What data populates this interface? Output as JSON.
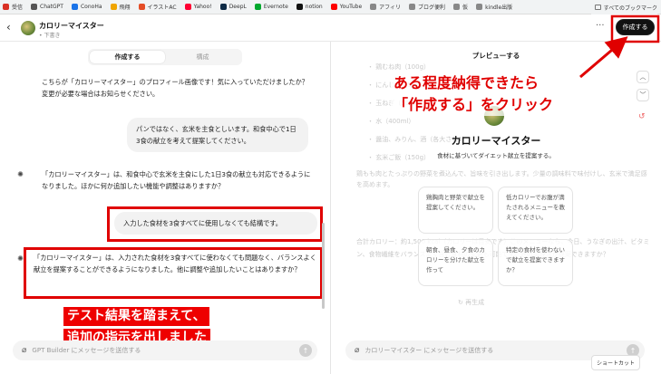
{
  "bookmarks": [
    {
      "label": "受信",
      "color": "#d93025"
    },
    {
      "label": "ChatGPT",
      "color": "#555555"
    },
    {
      "label": "ConoHa",
      "color": "#1a73e8"
    },
    {
      "label": "飛翔",
      "color": "#f0a500"
    },
    {
      "label": "イラストAC",
      "color": "#e44d26"
    },
    {
      "label": "Yahoo!",
      "color": "#ff0033"
    },
    {
      "label": "DeepL",
      "color": "#0f2b46"
    },
    {
      "label": "Evernote",
      "color": "#00a82d"
    },
    {
      "label": "notion",
      "color": "#111111"
    },
    {
      "label": "YouTube",
      "color": "#ff0000"
    },
    {
      "label": "アフィリ",
      "color": "#888888"
    },
    {
      "label": "ブログ便利",
      "color": "#888888"
    },
    {
      "label": "仮",
      "color": "#888888"
    },
    {
      "label": "kindle出版",
      "color": "#888888"
    }
  ],
  "bookmarks_all": "すべてのブックマーク",
  "header": {
    "back": "‹",
    "title": "カロリーマイスター",
    "subtitle": "• 下書き",
    "more": "···",
    "create_label": "作成する"
  },
  "tabs": {
    "create": "作成する",
    "configure": "構成"
  },
  "chat": {
    "m1": "こちらが「カロリーマイスター」のプロフィール画像です！気に入っていただけましたか？変更が必要な場合はお知らせください。",
    "u1": "パンではなく、玄米を主食としいます。和食中心で1日3食の献立を考えて提案してください。",
    "m2": "「カロリーマイスター」は、和食中心で玄米を主食にした1日3食の献立も対応できるようになりました。ほかに何か追加したい機能や調整はありますか？",
    "u2": "入力した食材を3食すべてに使用しなくても結構です。",
    "m3": "「カロリーマイスター」は、入力された食材を3食すべてに使わなくても問題なく、バランスよく献立を提案することができるようになりました。他に調整や追加したいことはありますか？"
  },
  "annotation_left": [
    "テスト結果を踏まえて、",
    "追加の指示を出しました"
  ],
  "left_input_placeholder": "GPT Builder にメッセージを送信する",
  "preview": {
    "title": "プレビューする",
    "faded_lines": [
      "・ 鶏むね肉（100g）",
      "・ にんじん（50g）",
      "・ 玉ねぎ（50g）",
      "・ 水（400ml）",
      "・ 醤油、みりん、酒（各大さじ1）",
      "・ 玄米ご飯（150g）"
    ],
    "faded_p1": "鶏もも肉とたっぷりの野菜を煮込んで、旨味を引き出します。少量の調味料で味付けし、玄米で満足感を高めます。",
    "faded_p2": "合計カロリー：約1,500 kcal（カロリーは目安です）このメニューなら、今日、うなぎの出汁、ビタミン、食物繊維をバランスよく含む食材の変更も可能です。他の調理法が提案できますか？",
    "gpt_name": "カロリーマイスター",
    "gpt_desc": "食材に基づいてダイエット献立を提案する。",
    "suggestions": [
      "鶏胸肉と野菜で献立を提案してください。",
      "低カロリーでお腹が満たされるメニューを教えてください。",
      "朝食、昼食、夕食のカロリーを分けた献立を作って",
      "特定の食材を使わないで献立を提案できますか？"
    ],
    "faded_reload": "↻ 再生成",
    "annotation": [
      "ある程度納得できたら",
      "「作成する」をクリック"
    ],
    "input_placeholder": "カロリーマイスター にメッセージを送信する",
    "shortcut": "ショートカット"
  }
}
